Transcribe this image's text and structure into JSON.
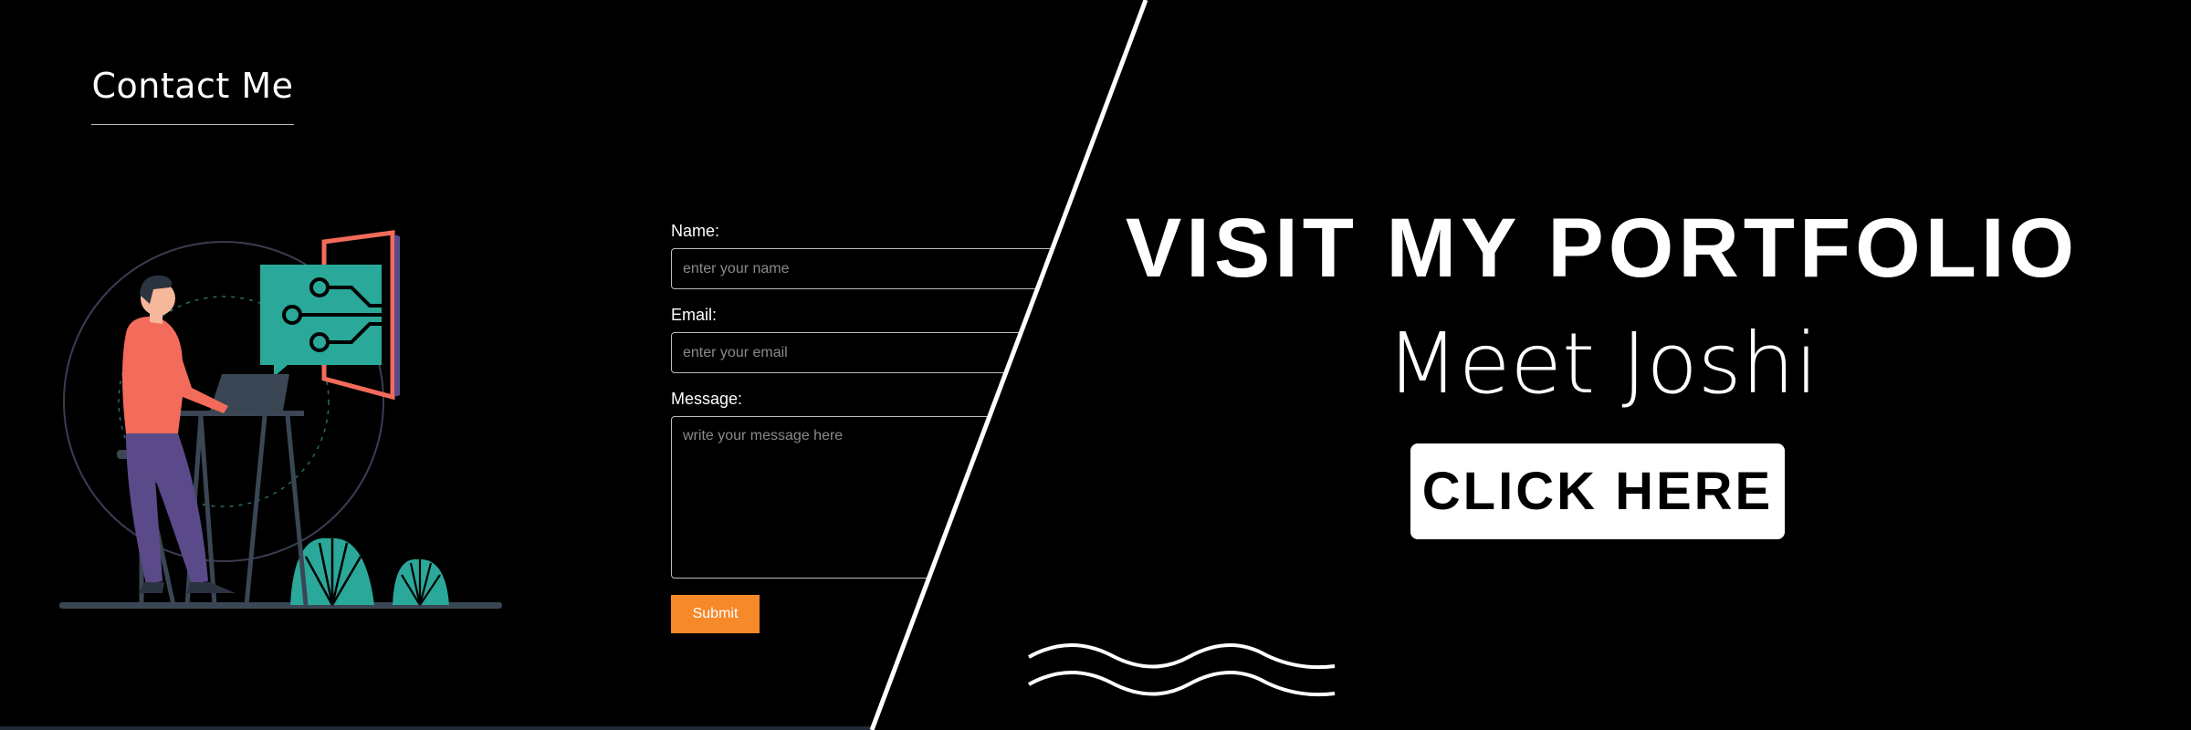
{
  "contact": {
    "heading": "Contact Me",
    "name_label": "Name:",
    "name_placeholder": "enter your name",
    "email_label": "Email:",
    "email_placeholder": "enter your email",
    "message_label": "Message:",
    "message_placeholder": "write your message here",
    "submit_label": "Submit"
  },
  "promo": {
    "title": "VISIT MY PORTFOLIO",
    "subtitle": "Meet Joshi",
    "cta_label": "CLICK HERE"
  },
  "colors": {
    "background": "#000000",
    "submit": "#f6892a",
    "teal": "#2aa89a",
    "coral": "#f26b5b",
    "purple": "#5b4a8a"
  }
}
